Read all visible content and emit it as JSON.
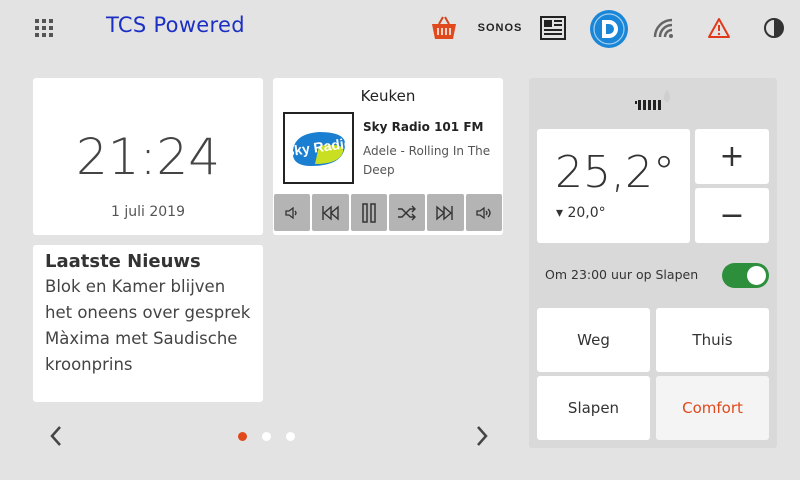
{
  "header": {
    "brand": "TCS Powered",
    "sonos_label": "SONOS",
    "icons": [
      "apps-grid-icon",
      "shopping-basket-icon",
      "sonos-icon",
      "news-icon",
      "d-logo-icon",
      "wifi-icon",
      "warning-icon",
      "contrast-icon"
    ]
  },
  "clock": {
    "time": "21:24",
    "date": "1 juli 2019"
  },
  "news": {
    "title": "Laatste Nieuws",
    "body": "Blok en Kamer blijven het oneens over gesprek Màxima met Saudische kroonprins"
  },
  "sonos": {
    "room": "Keuken",
    "logo_text": "Sky Radio",
    "station": "Sky Radio 101 FM",
    "track": "Adele - Rolling In The Deep",
    "controls": [
      "volume-down-icon",
      "previous-icon",
      "pause-icon",
      "shuffle-icon",
      "next-icon",
      "volume-up-icon"
    ]
  },
  "thermostat": {
    "current_temp": "25,2°",
    "setpoint": "▾ 20,0°",
    "plus": "+",
    "minus": "−",
    "schedule_text": "Om 23:00 uur op Slapen",
    "schedule_enabled": true,
    "modes": {
      "weg": "Weg",
      "thuis": "Thuis",
      "slapen": "Slapen",
      "comfort": "Comfort"
    },
    "active_mode": "Comfort"
  },
  "pager": {
    "pages": 3,
    "active_page": 1
  },
  "colors": {
    "accent": "#e0491b",
    "brand_blue": "#1c2fc4",
    "toggle_green": "#2d8f3c",
    "d_logo_blue": "#1a86d8"
  }
}
